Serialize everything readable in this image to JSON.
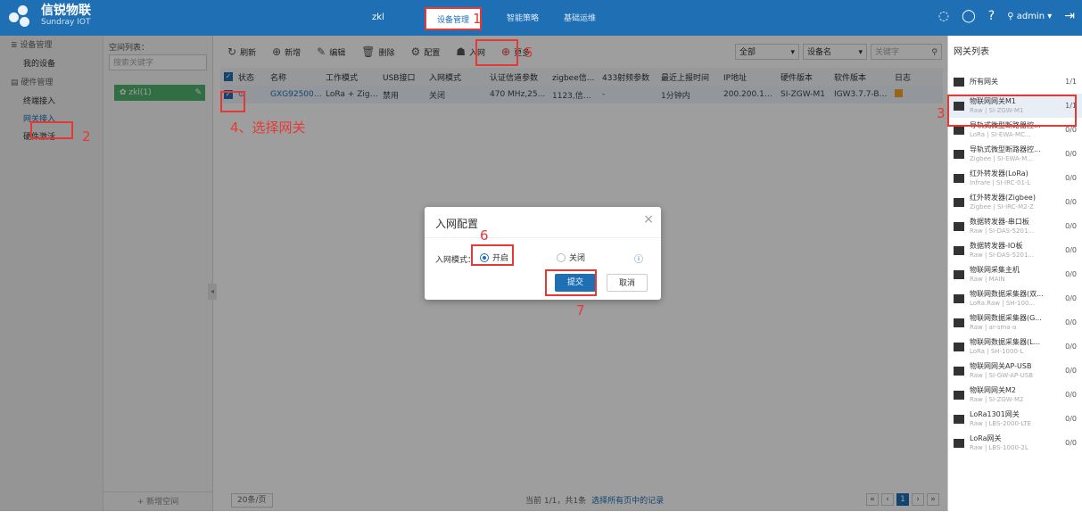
{
  "header": {
    "logo_cn": "信锐物联",
    "logo_en": "Sundray IOT",
    "user_node": "zkl",
    "tabs": [
      "设备管理",
      "智能策略",
      "基础运维"
    ],
    "admin": "admin"
  },
  "annotations": {
    "n1": "1",
    "n2": "2",
    "n3": "3",
    "n4": "4、选择网关",
    "n5": "5",
    "n6": "6",
    "n7": "7"
  },
  "leftnav": {
    "group1": "设备管理",
    "group1_items": [
      "我的设备"
    ],
    "group2": "硬件管理",
    "group2_items": [
      "终端接入",
      "网关接入",
      "硬件激活"
    ]
  },
  "tree": {
    "title": "空间列表：",
    "search_placeholder": "搜索关键字",
    "node": "zkl(1)",
    "add_label": "+ 新增空间"
  },
  "toolbar": {
    "refresh": "刷新",
    "add": "新增",
    "edit": "编辑",
    "delete": "删除",
    "config": "配置",
    "join": "入网",
    "more": "更多",
    "filter_all": "全部",
    "filter_field": "设备名",
    "keyword_placeholder": "关键字"
  },
  "table": {
    "headers": [
      "状态",
      "名称",
      "工作模式",
      "USB接口",
      "入网模式",
      "认证信道参数",
      "zigbee信...",
      "433射频参数",
      "最近上报时间",
      "IP地址",
      "硬件版本",
      "软件版本",
      "日志"
    ],
    "row": {
      "status": "⊙",
      "name": "GXG9250008",
      "mode": "LoRa + ZigB...",
      "usb": "禁用",
      "join_mode": "关闭",
      "auth": "470 MHz,25...",
      "zigbee": "1123,信道11...",
      "rf433": "-",
      "last_report": "1分钟内",
      "ip": "200.200.159...",
      "hw": "SI-ZGW-M1",
      "sw": "IGW3.7.7-Bu..."
    }
  },
  "pager": {
    "size": "20条/页",
    "info": "当前 1/1，共1条",
    "select_link": "选择所有页中的记录",
    "current_page": "1"
  },
  "gateways": {
    "title": "网关列表",
    "all_label": "所有网关",
    "all_count": "1/1",
    "items": [
      {
        "name": "物联网网关M1",
        "sub": "Raw | SI-ZGW-M1",
        "count": "1/1"
      },
      {
        "name": "导轨式微型断路器控...",
        "sub": "LoRa | SI-EWA-MC...",
        "count": "0/0"
      },
      {
        "name": "导轨式微型断路器控...",
        "sub": "Zigbee | SI-EWA-M...",
        "count": "0/0"
      },
      {
        "name": "红外转发器(LoRa)",
        "sub": "Infrare | SI-IRC-01-L",
        "count": "0/0"
      },
      {
        "name": "红外转发器(Zigbee)",
        "sub": "Zigbee | SI-IRC-M2-Z",
        "count": "0/0"
      },
      {
        "name": "数据转发器-串口板",
        "sub": "Raw | SI-DAS-5201...",
        "count": "0/0"
      },
      {
        "name": "数据转发器-IO板",
        "sub": "Raw | SI-DAS-5201...",
        "count": "0/0"
      },
      {
        "name": "物联网采集主机",
        "sub": "Raw | MAIN",
        "count": "0/0"
      },
      {
        "name": "物联网数据采集器(双...",
        "sub": "LoRa.Raw | SH-100...",
        "count": "0/0"
      },
      {
        "name": "物联网数据采集器(G...",
        "sub": "Raw | ar-sma-a",
        "count": "0/0"
      },
      {
        "name": "物联网数据采集器(L...",
        "sub": "LoRa | SH-1000-L",
        "count": "0/0"
      },
      {
        "name": "物联网网关AP-USB",
        "sub": "Raw | SI-GW-AP-USB",
        "count": "0/0"
      },
      {
        "name": "物联网网关M2",
        "sub": "Raw | SI-ZGW-M2",
        "count": "0/0"
      },
      {
        "name": "LoRa1301网关",
        "sub": "Raw | LBS-2000-LTE",
        "count": "0/0"
      },
      {
        "name": "LoRa网关",
        "sub": "Raw | LBS-1000-2L",
        "count": "0/0"
      }
    ]
  },
  "modal": {
    "title": "入网配置",
    "mode_label": "入网模式：",
    "opt_on": "开启",
    "opt_off": "关闭",
    "submit": "提交",
    "cancel": "取消"
  }
}
